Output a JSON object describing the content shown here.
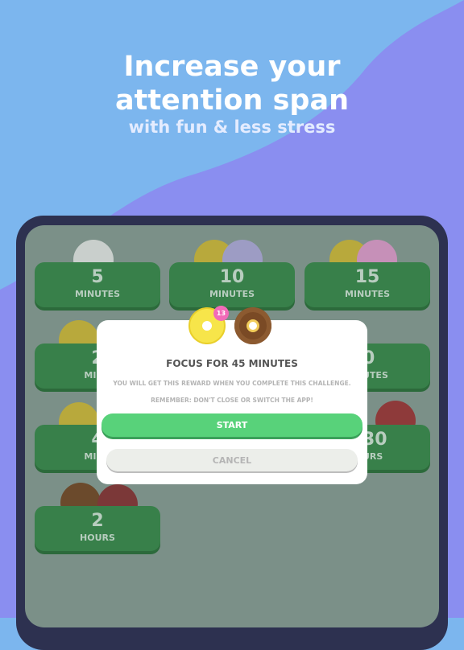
{
  "hero": {
    "line1": "Increase your",
    "line2": "attention span",
    "line3": "with fun & less stress"
  },
  "colors": {
    "sky": "#7cb6ee",
    "wave": "#8a8ef0",
    "tile": "#38804a",
    "start": "#58d27a",
    "badge": "#f26bb8"
  },
  "tiles": [
    {
      "num": "5",
      "unit": "MINUTES"
    },
    {
      "num": "10",
      "unit": "MINUTES"
    },
    {
      "num": "15",
      "unit": "MINUTES"
    },
    {
      "num": "2",
      "unit": "MINU"
    },
    {
      "num": "0",
      "unit": "UTES"
    },
    {
      "num": "4",
      "unit": "MINU"
    },
    {
      "num": "30",
      "unit": "URS"
    },
    {
      "num": "2",
      "unit": "HOURS"
    }
  ],
  "modal": {
    "coin_count": "13",
    "title": "FOCUS FOR 45 MINUTES",
    "message1": "YOU WILL GET THIS REWARD WHEN YOU COMPLETE THIS CHALLENGE.",
    "message2": "REMEMBER: DON'T CLOSE OR SWITCH THE APP!",
    "start_label": "START",
    "cancel_label": "CANCEL",
    "reward_icons": [
      "gold-coin-icon",
      "chocolate-donut-icon"
    ]
  }
}
